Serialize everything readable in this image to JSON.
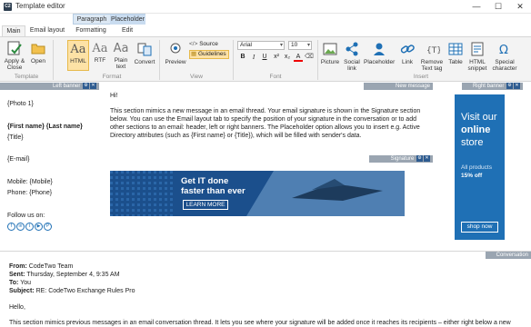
{
  "window": {
    "title": "Template editor",
    "minimize": "—",
    "maximize": "☐",
    "close": "✕"
  },
  "context_tabs": [
    "Paragraph",
    "Placeholder"
  ],
  "ribbon_tabs": [
    "Main",
    "Email layout",
    "Formatting",
    "Edit"
  ],
  "ribbon": {
    "apply_close": "Apply & Close",
    "open": "Open",
    "html": "HTML",
    "rtf": "RTF",
    "plain_text": "Plain text",
    "convert": "Convert",
    "preview": "Preview",
    "source": "Source",
    "guidelines": "Guidelines",
    "font_name": "Arial",
    "font_size": "10",
    "picture": "Picture",
    "social_link": "Social link",
    "placeholder": "Placeholder",
    "link": "Link",
    "remove_text_tag": "Remove Text tag",
    "table": "Table",
    "html_snippet": "HTML snippet",
    "special_character": "Special character",
    "groups": {
      "template": "Template",
      "format": "Format",
      "view": "View",
      "font": "Font",
      "insert": "Insert"
    }
  },
  "left_banner": {
    "label": "Left banner",
    "photo": "{Photo 1}",
    "name": "{First name} {Last name}",
    "title": "{Title}",
    "email": "{E-mail}",
    "mobile": "Mobile: {Mobile}",
    "phone": "Phone: {Phone}",
    "follow": "Follow us on:"
  },
  "new_message": {
    "label": "New message",
    "greeting": "Hi!",
    "body": "This section mimics a new message in an email thread. Your email signature is shown in the Signature section below. You can use the Email layout tab to specify the position of your signature in the conversation or to add other sections to an email: header, left or right banners. The Placeholder option allows you to insert e.g. Active Directory attributes (such as {First name} or {Title}), which will be filled with sender's data."
  },
  "signature": {
    "label": "Signature",
    "headline_line1": "Get IT done",
    "headline_line2": "faster than ever",
    "cta": "LEARN MORE"
  },
  "right_banner": {
    "label": "Right banner",
    "line1": "Visit our",
    "line2": "online",
    "line3": "store",
    "sub1": "All products",
    "sub2": "15% off",
    "cta": "shop now"
  },
  "conversation": {
    "label": "Conversation",
    "from_label": "From:",
    "from": "CodeTwo Team",
    "sent_label": "Sent:",
    "sent": "Thursday, September 4, 9:35 AM",
    "to_label": "To:",
    "to": "You",
    "subject_label": "Subject:",
    "subject": "RE: CodeTwo Exchange Rules Pro",
    "hello": "Hello,",
    "body": "This section mimics previous messages in an email conversation thread. It lets you see where your signature will be added once it reaches its recipients – either right below a new"
  },
  "colors": {
    "accent": "#1f70b5",
    "banner_dark": "#1b4f8c",
    "pane_header": "#9aa5b1",
    "ribbon_bg": "#f3f3f3"
  }
}
